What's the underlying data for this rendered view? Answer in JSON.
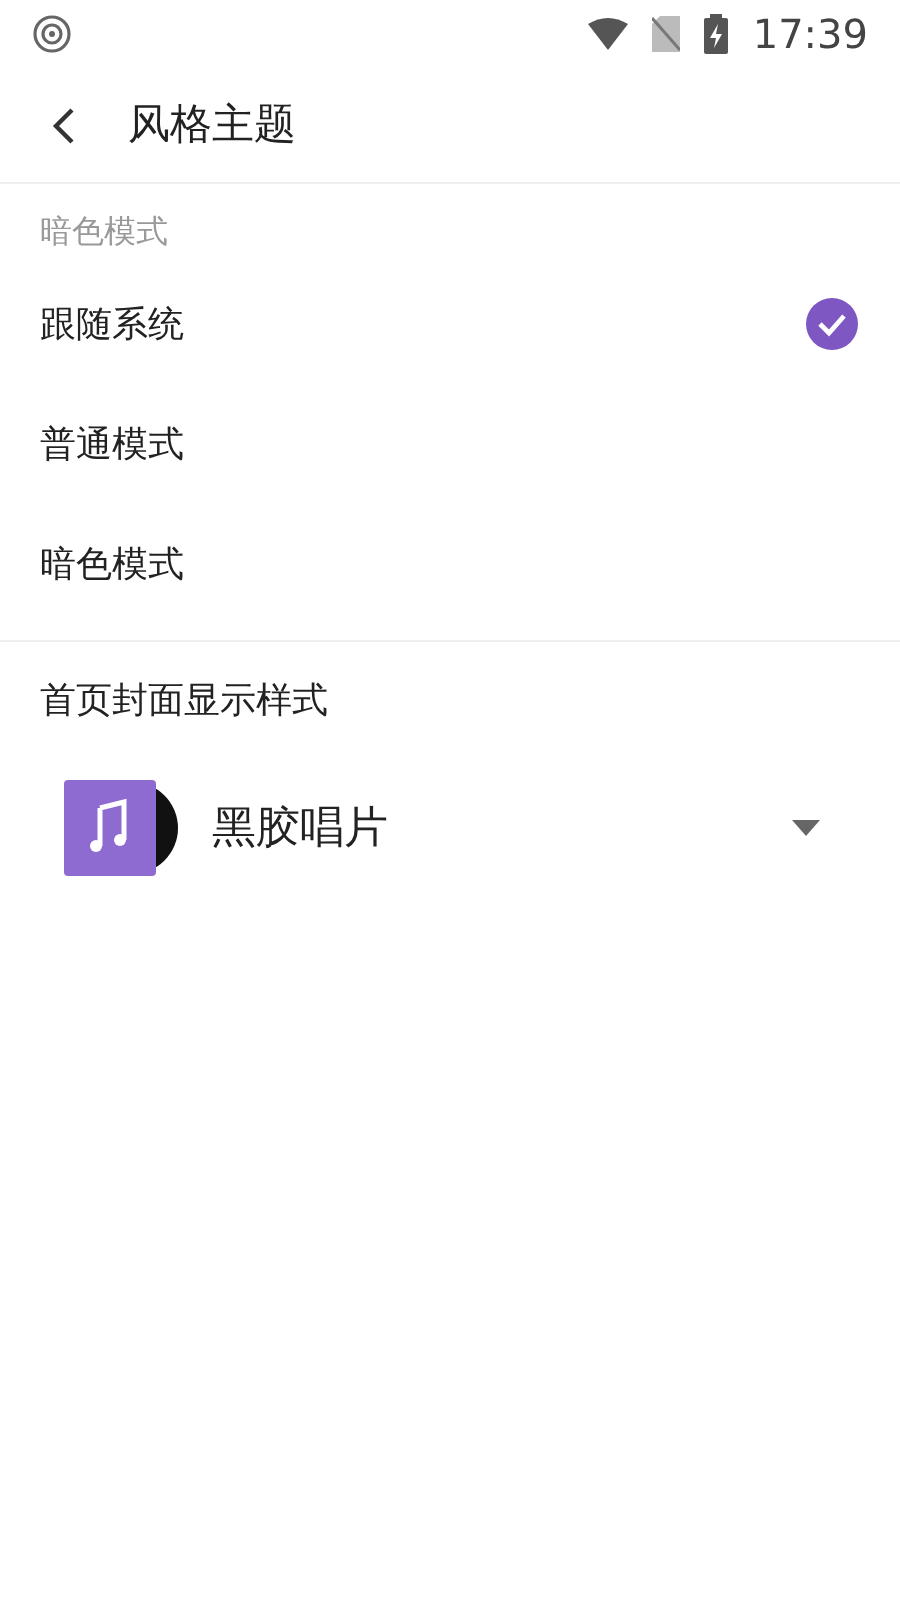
{
  "status_bar": {
    "time": "17:39"
  },
  "header": {
    "title": "风格主题"
  },
  "dark_mode": {
    "heading": "暗色模式",
    "options": [
      {
        "label": "跟随系统",
        "selected": true
      },
      {
        "label": "普通模式",
        "selected": false
      },
      {
        "label": "暗色模式",
        "selected": false
      }
    ]
  },
  "cover_style": {
    "heading": "首页封面显示样式",
    "dropdown": {
      "value": "黑胶唱片"
    }
  }
}
